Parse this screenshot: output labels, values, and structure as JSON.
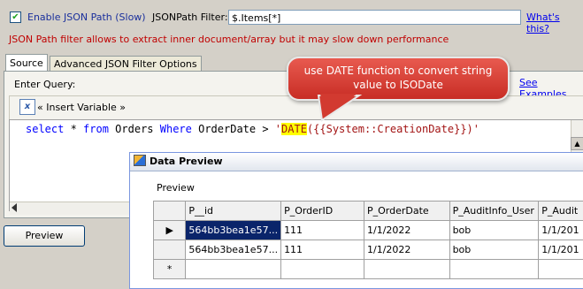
{
  "filter_row": {
    "enable_label": "Enable JSON Path (Slow)",
    "jsonpath_label": "JSONPath Filter:",
    "jsonpath_value": "$.Items[*]",
    "whats_this": "What's this?",
    "hint": "JSON Path filter allows to extract inner document/array but it may slow down performance"
  },
  "tabs": [
    {
      "label": "Source"
    },
    {
      "label": "Advanced JSON Filter Options"
    }
  ],
  "query": {
    "enter_label": "Enter Query:",
    "see_examples": "See Examples",
    "insert_variable": "« Insert Variable »",
    "code_kw_select": "select",
    "code_star": " * ",
    "code_kw_from": "from",
    "code_table": " Orders ",
    "code_kw_where": "Where",
    "code_field": " OrderDate > ",
    "code_quote_open": "'",
    "code_fn": "DATE",
    "code_arg": "({{System::CreationDate}})'"
  },
  "callout": {
    "text": "use DATE function to convert string value to ISODate"
  },
  "preview_button": "Preview",
  "data_preview": {
    "title": "Data Preview",
    "section_label": "Preview",
    "columns": [
      "P__id",
      "P_OrderID",
      "P_OrderDate",
      "P_AuditInfo_User",
      "P_Audit"
    ],
    "rows": [
      [
        "564bb3bea1e57...",
        "111",
        "1/1/2022",
        "bob",
        "1/1/201"
      ],
      [
        "564bb3bea1e57...",
        "111",
        "1/1/2022",
        "bob",
        "1/1/201"
      ]
    ],
    "row_markers": [
      "▶",
      "",
      "*"
    ]
  },
  "colors": {
    "callout": "#d23a30",
    "hint_text": "#c00000",
    "selected_cell": "#0a246a"
  }
}
